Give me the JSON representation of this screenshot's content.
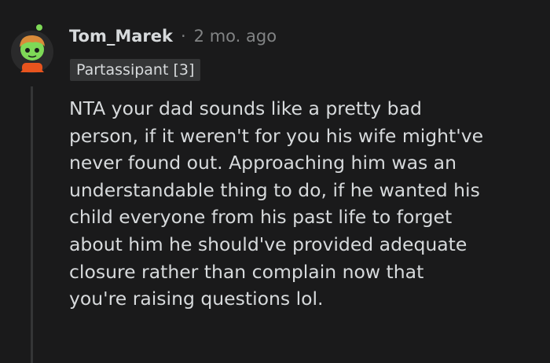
{
  "comment": {
    "author": "Tom_Marek",
    "separator": "·",
    "age": "2 mo. ago",
    "flair": "Partassipant [3]",
    "body_lines": [
      "NTA your dad sounds like a pretty bad",
      "person, if it weren't for you his wife might've",
      "never found out. Approaching him was an",
      "understandable thing to do, if he wanted his",
      "child everyone from his past life to forget",
      "about him he should've provided adequate",
      "closure rather than complain now that",
      "you're raising questions lol."
    ]
  },
  "colors": {
    "background": "#1a1a1b",
    "text": "#d7dadc",
    "meta": "#818384",
    "flair_bg": "#343536",
    "avatar_skin": "#7ed957",
    "avatar_hair": "#d98b3a",
    "avatar_shirt": "#e8541e"
  }
}
